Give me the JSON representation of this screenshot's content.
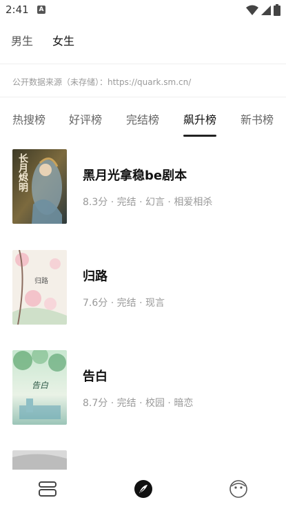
{
  "status_bar": {
    "time": "2:41",
    "notification_badge": "A",
    "icons": [
      "wifi-icon",
      "signal-icon",
      "battery-icon"
    ]
  },
  "gender_tabs": {
    "male": "男生",
    "female": "女生",
    "active": "female"
  },
  "source_note": "公开数据来源（未存储）：https://quark.sm.cn/",
  "rank_tabs": [
    {
      "label": "热搜榜"
    },
    {
      "label": "好评榜"
    },
    {
      "label": "完结榜"
    },
    {
      "label": "飙升榜"
    },
    {
      "label": "新书榜"
    }
  ],
  "active_rank_tab": "飙升榜",
  "books": [
    {
      "title": "黑月光拿稳be剧本",
      "meta": "8.3分 · 完结 · 幻言 · 相爱相杀",
      "cover_text": "长月烬明",
      "cover_icon": "book-cover-1"
    },
    {
      "title": "归路",
      "meta": "7.6分 · 完结 · 现言",
      "cover_text": "归路",
      "cover_icon": "book-cover-2"
    },
    {
      "title": "告白",
      "meta": "8.7分 · 完结 · 校园 · 暗恋",
      "cover_text": "告白",
      "cover_icon": "book-cover-3"
    }
  ],
  "bottom_nav": {
    "items": [
      "bookshelf-icon",
      "discover-icon",
      "profile-icon"
    ],
    "active": "discover-icon"
  },
  "colors": {
    "active_text": "#111111",
    "inactive_text": "#666666",
    "meta_text": "#999999",
    "accent": "#222222"
  }
}
